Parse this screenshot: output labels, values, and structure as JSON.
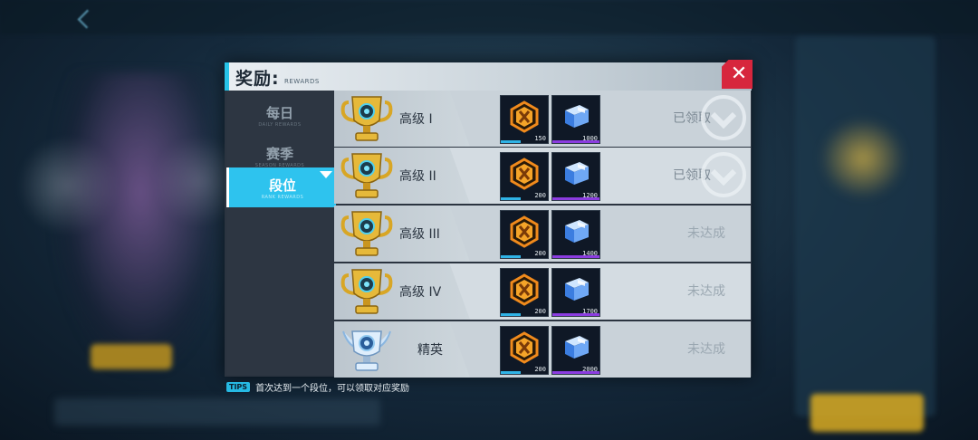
{
  "modal": {
    "title": "奖励:",
    "subtitle": "REWARDS"
  },
  "tabs": [
    {
      "label": "每日",
      "sub": "DAILY REWARDS",
      "active": false
    },
    {
      "label": "赛季",
      "sub": "SEASON REWARDS",
      "active": false
    },
    {
      "label": "段位",
      "sub": "RANK REWARDS",
      "active": true
    }
  ],
  "ranks": [
    {
      "name": "高级 I",
      "coin_qty": "150",
      "box_qty": "1000",
      "status": "已领取",
      "claimed": true,
      "trophy": "gold-trophy-icon"
    },
    {
      "name": "高级 II",
      "coin_qty": "200",
      "box_qty": "1200",
      "status": "已领取",
      "claimed": true,
      "trophy": "gold-trophy-icon"
    },
    {
      "name": "高级 III",
      "coin_qty": "200",
      "box_qty": "1400",
      "status": "未达成",
      "claimed": false,
      "trophy": "gold-trophy-icon"
    },
    {
      "name": "高级 IV",
      "coin_qty": "200",
      "box_qty": "1700",
      "status": "未达成",
      "claimed": false,
      "trophy": "gold-trophy-icon"
    },
    {
      "name": "精英",
      "coin_qty": "200",
      "box_qty": "2000",
      "status": "未达成",
      "claimed": false,
      "trophy": "silver-trophy-icon"
    }
  ],
  "tips": {
    "badge": "TIPS",
    "text": "首次达到一个段位，可以领取对应奖励"
  },
  "colors": {
    "accent": "#2ec3ee",
    "close": "#d7263d",
    "coin": "#f08a1c",
    "box": "#3b7de0"
  }
}
